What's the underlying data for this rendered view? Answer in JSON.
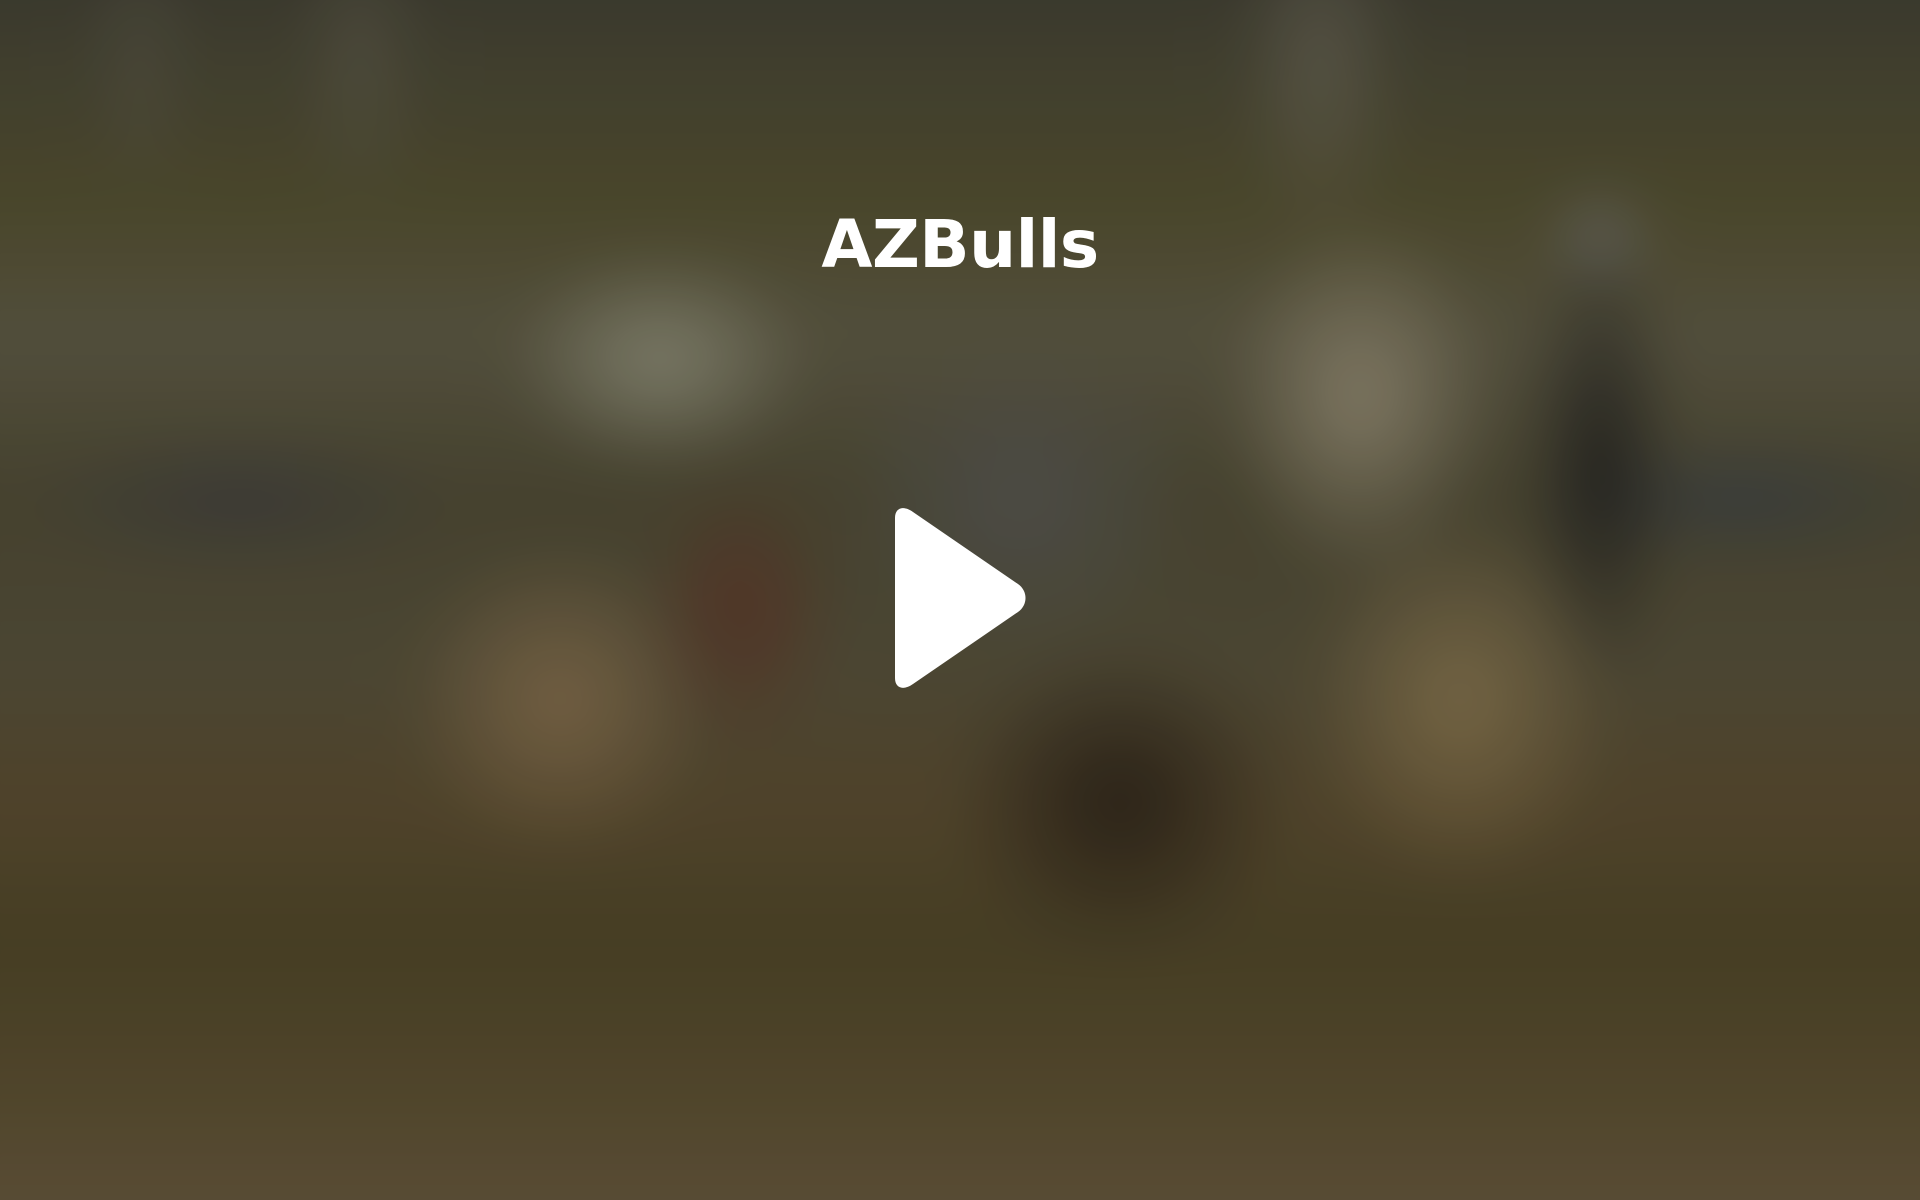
{
  "video_poster": {
    "title": "AZBulls",
    "play_icon": "play-icon"
  },
  "colors": {
    "title_text": "#ffffff",
    "play_icon": "#ffffff"
  }
}
